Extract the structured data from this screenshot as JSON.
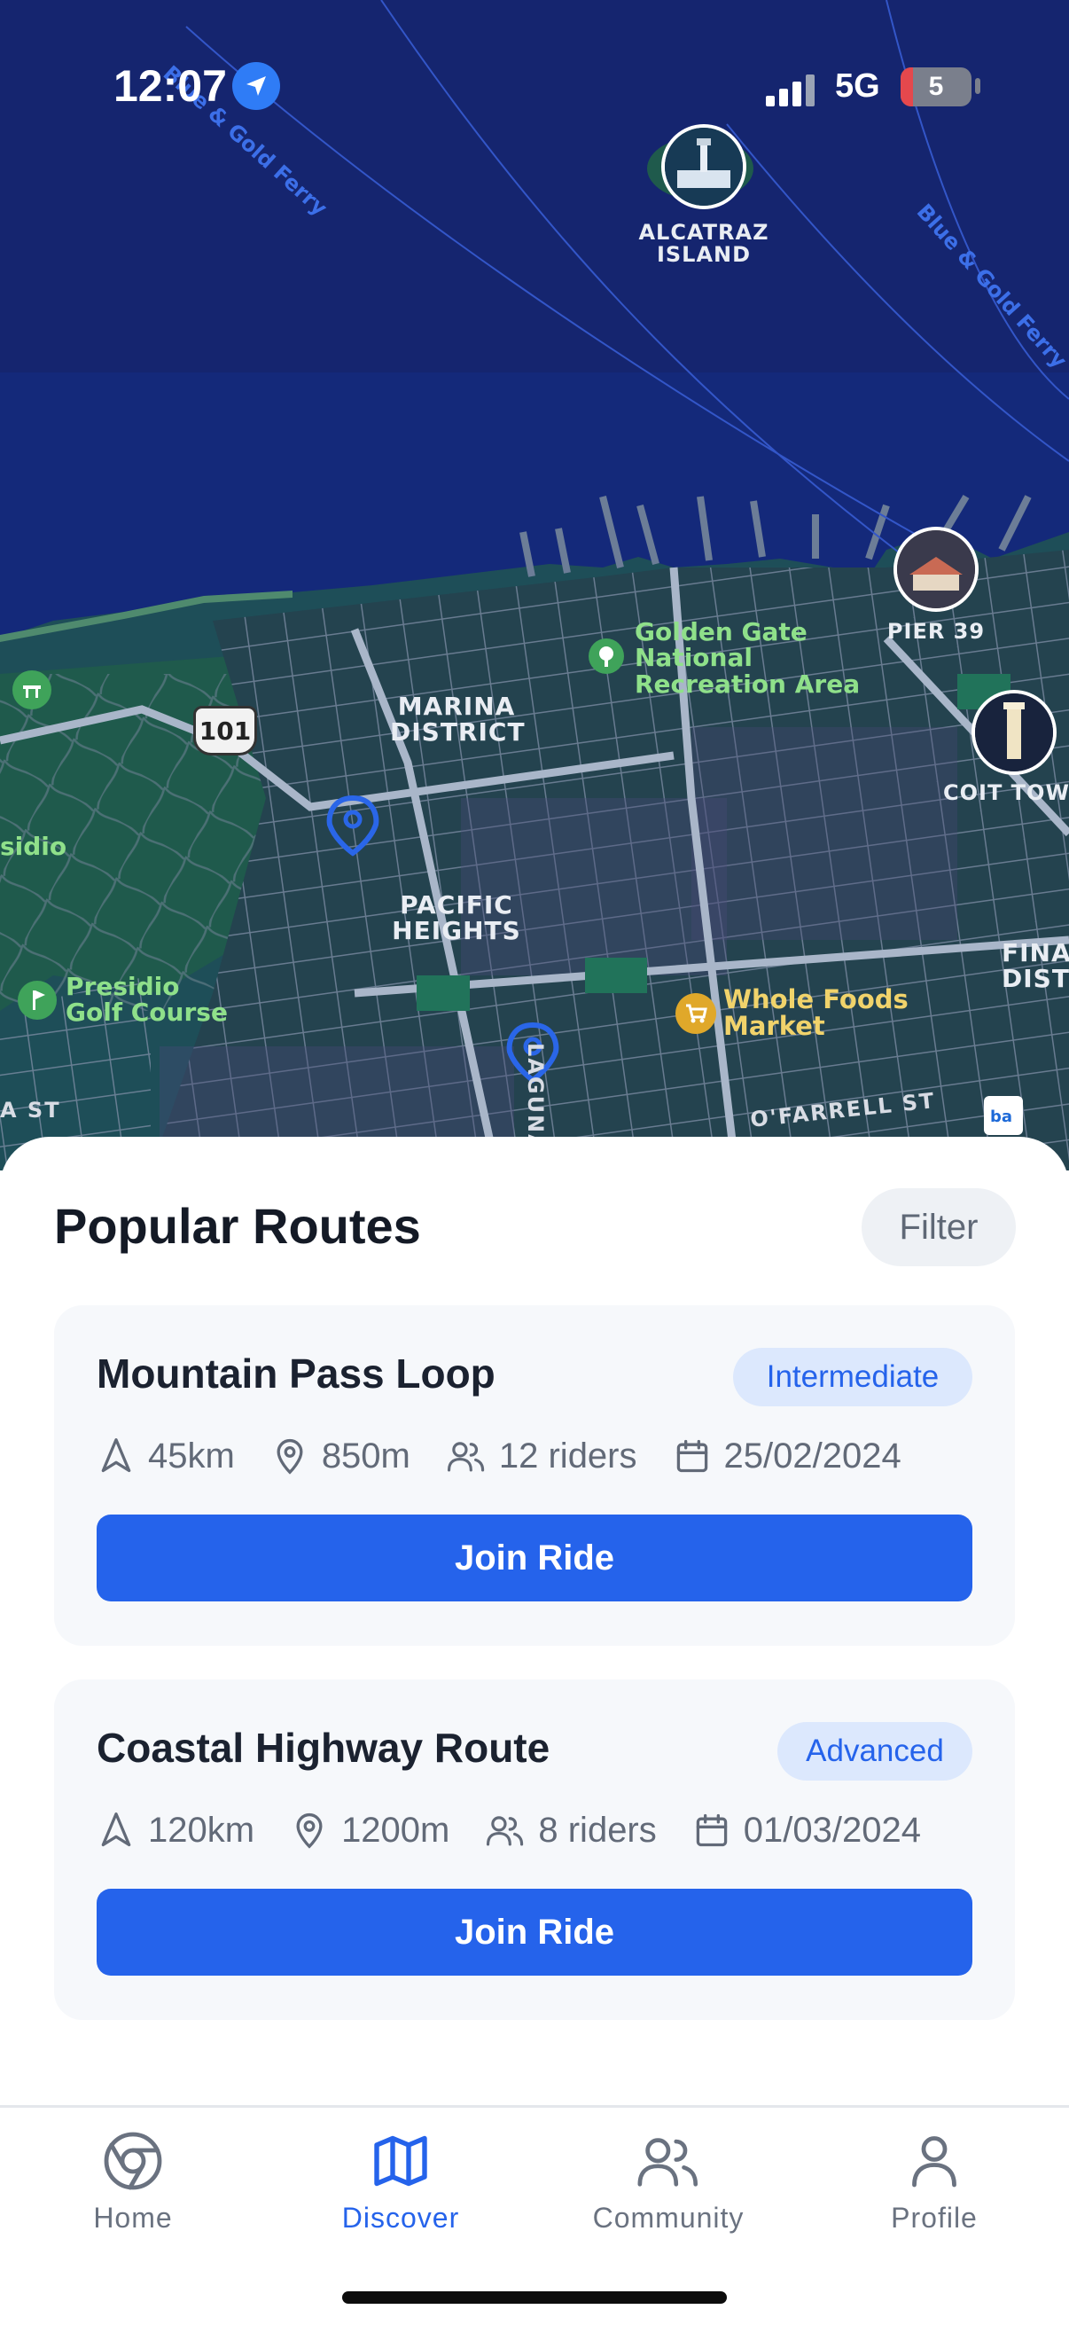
{
  "status_bar": {
    "time": "12:07",
    "network": "5G",
    "battery": "5",
    "icons": [
      "location-arrow-icon",
      "signal-bars-icon",
      "battery-icon"
    ]
  },
  "map": {
    "labels": {
      "alcatraz": "ALCATRAZ\nISLAND",
      "pier39": "PIER 39",
      "coit": "COIT TOWER",
      "marina": "MARINA\nDISTRICT",
      "pacific": "PACIFIC\nHEIGHTS",
      "golden_gate": "Golden Gate\nNational\nRecreation Area",
      "presidio": "sidio",
      "presidio_golf": "Presidio\nGolf Course",
      "whole_foods": "Whole Foods\nMarket",
      "financial": "FINAN\nDIST",
      "laguna": "LAGUNA ST",
      "ofarrell": "O'FARRELL ST",
      "st_left": "A ST",
      "hwy": "101",
      "ferry1": "Blue & Gold Ferry",
      "ferry2": "Blue & Gold Ferry"
    },
    "colors": {
      "water": "#14297a",
      "land": "#1f4a55",
      "roads": "#8f9eb3",
      "pin": "#2a66e8"
    }
  },
  "sheet": {
    "title": "Popular Routes",
    "filter_label": "Filter",
    "routes": [
      {
        "name": "Mountain Pass Loop",
        "difficulty": "Intermediate",
        "distance": "45km",
        "elevation": "850m",
        "riders": "12 riders",
        "date": "25/02/2024",
        "button": "Join Ride"
      },
      {
        "name": "Coastal Highway Route",
        "difficulty": "Advanced",
        "distance": "120km",
        "elevation": "1200m",
        "riders": "8 riders",
        "date": "01/03/2024",
        "button": "Join Ride"
      }
    ]
  },
  "tabs": [
    {
      "label": "Home",
      "icon": "chrome-icon",
      "active": false
    },
    {
      "label": "Discover",
      "icon": "map-icon",
      "active": true
    },
    {
      "label": "Community",
      "icon": "users-icon",
      "active": false
    },
    {
      "label": "Profile",
      "icon": "user-icon",
      "active": false
    }
  ],
  "colors": {
    "accent": "#2563eb",
    "badge_bg": "#dce8fd",
    "card_bg": "#f6f8fb"
  }
}
